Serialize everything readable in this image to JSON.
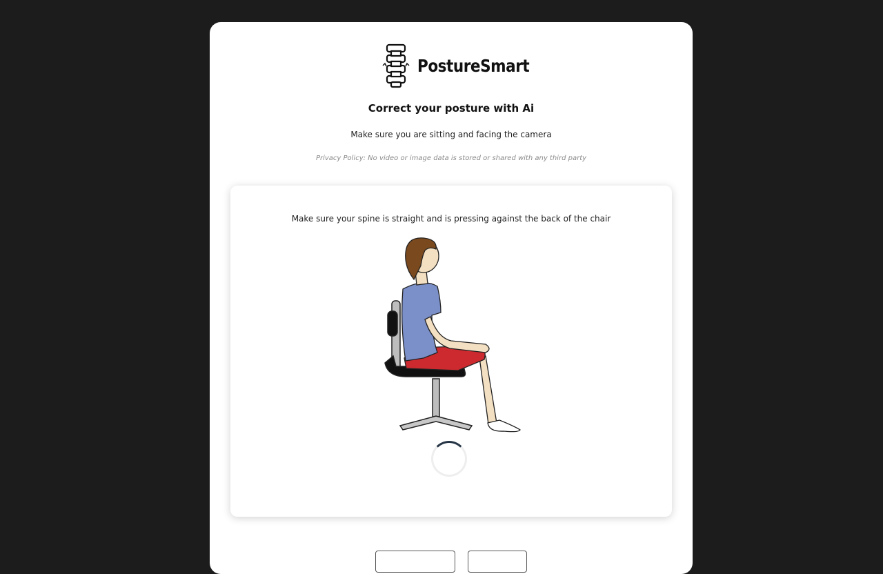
{
  "brand": {
    "name": "PostureSmart",
    "logo_icon": "spine-icon"
  },
  "header": {
    "title": "Correct your posture with Ai",
    "subtitle": "Make sure you are sitting and facing the camera",
    "privacy": "Privacy Policy: No video or image data is stored or shared with any third party"
  },
  "panel": {
    "instruction": "Make sure your spine is straight and is pressing against the back of the chair",
    "illustration_icon": "seated-posture-illustration",
    "status": "loading-spinner"
  },
  "colors": {
    "page_background": "#1c1c1c",
    "card_background": "#ffffff",
    "shirt": "#7b8fc9",
    "shorts": "#cc2a2f",
    "hair": "#7a4a1e",
    "spinner_accent": "#263545"
  }
}
